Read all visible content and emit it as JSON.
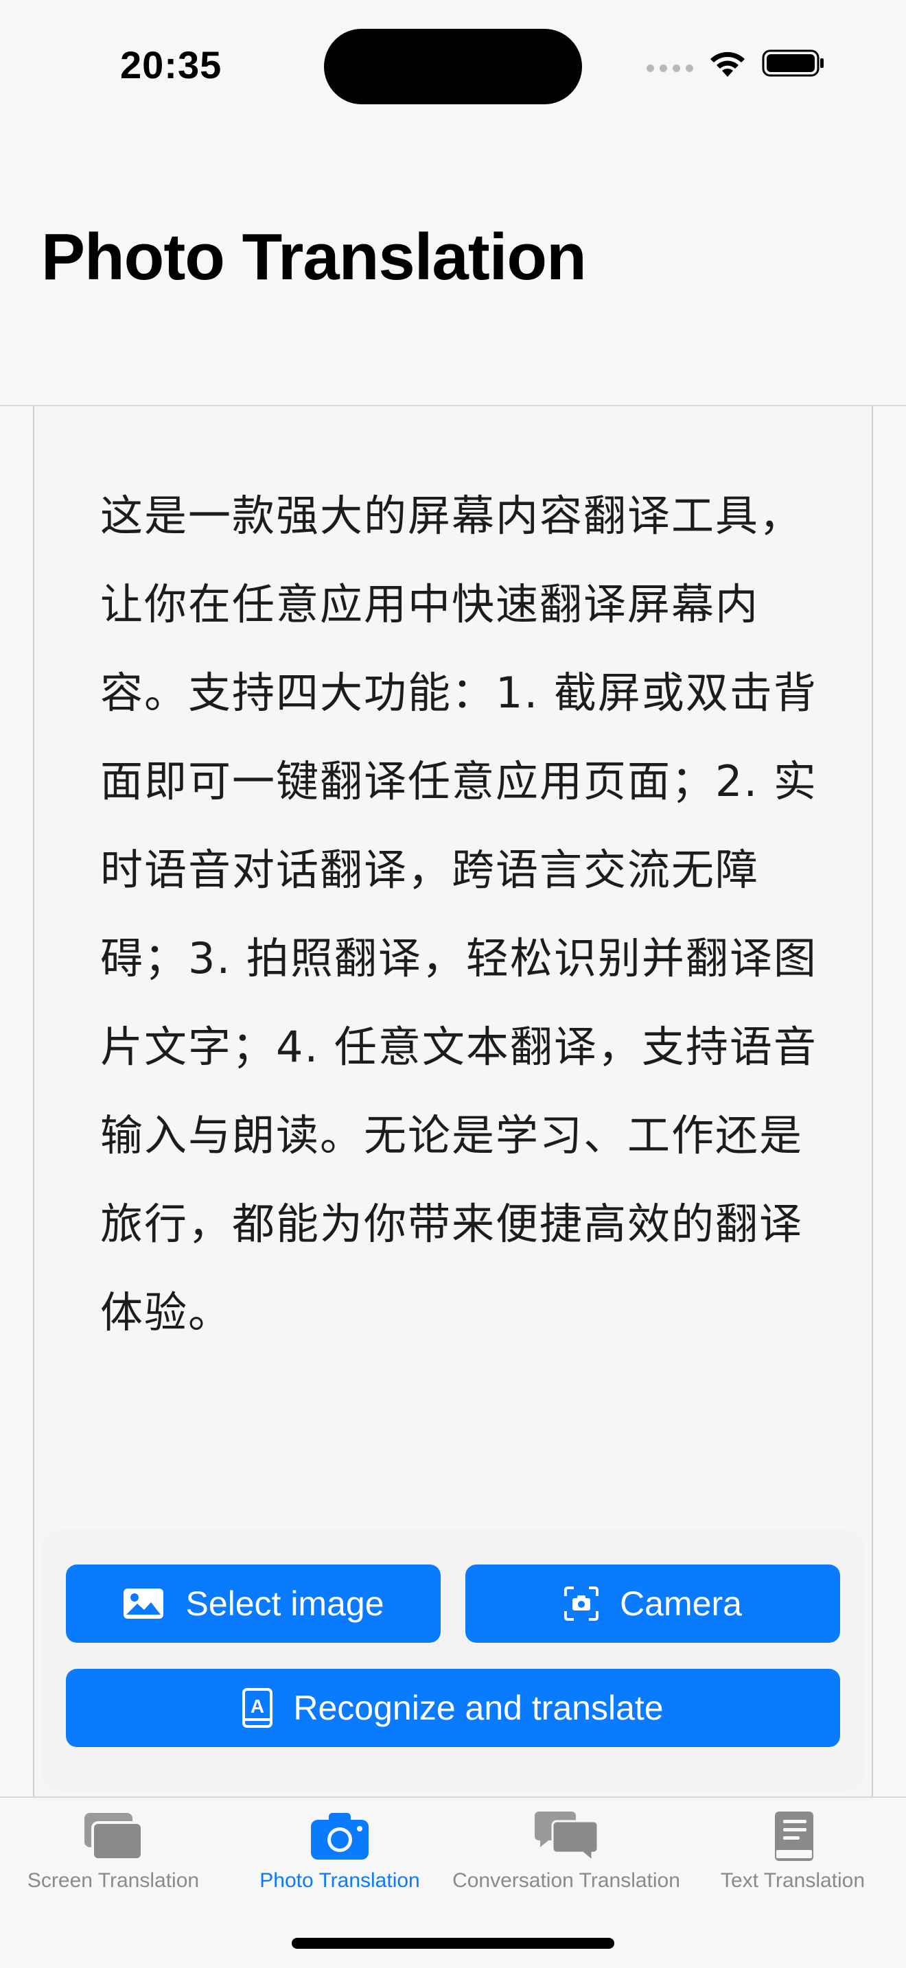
{
  "status_bar": {
    "time": "20:35",
    "icons": [
      "signal-dots-icon",
      "wifi-icon",
      "battery-icon"
    ]
  },
  "header": {
    "title": "Photo Translation"
  },
  "content": {
    "description": "这是一款强大的屏幕内容翻译工具，让你在任意应用中快速翻译屏幕内容。支持四大功能：1. 截屏或双击背面即可一键翻译任意应用页面；2. 实时语音对话翻译，跨语言交流无障碍；3. 拍照翻译，轻松识别并翻译图片文字；4. 任意文本翻译，支持语音输入与朗读。无论是学习、工作还是旅行，都能为你带来便捷高效的翻译体验。"
  },
  "actions": {
    "select_image": {
      "label": "Select image",
      "icon": "photo-icon"
    },
    "camera": {
      "label": "Camera",
      "icon": "camera-viewfinder-icon"
    },
    "recognize": {
      "label": "Recognize and translate",
      "icon": "translate-book-icon"
    }
  },
  "tab_bar": {
    "items": [
      {
        "label": "Screen Translation",
        "icon": "screens-stack-icon",
        "active": false
      },
      {
        "label": "Photo Translation",
        "icon": "camera-icon",
        "active": true
      },
      {
        "label": "Conversation Translation",
        "icon": "chat-bubbles-icon",
        "active": false
      },
      {
        "label": "Text Translation",
        "icon": "book-icon",
        "active": false
      }
    ]
  },
  "colors": {
    "accent": "#0a7bff",
    "inactive_tab": "#8a8a8a",
    "background": "#f7f7f7"
  }
}
